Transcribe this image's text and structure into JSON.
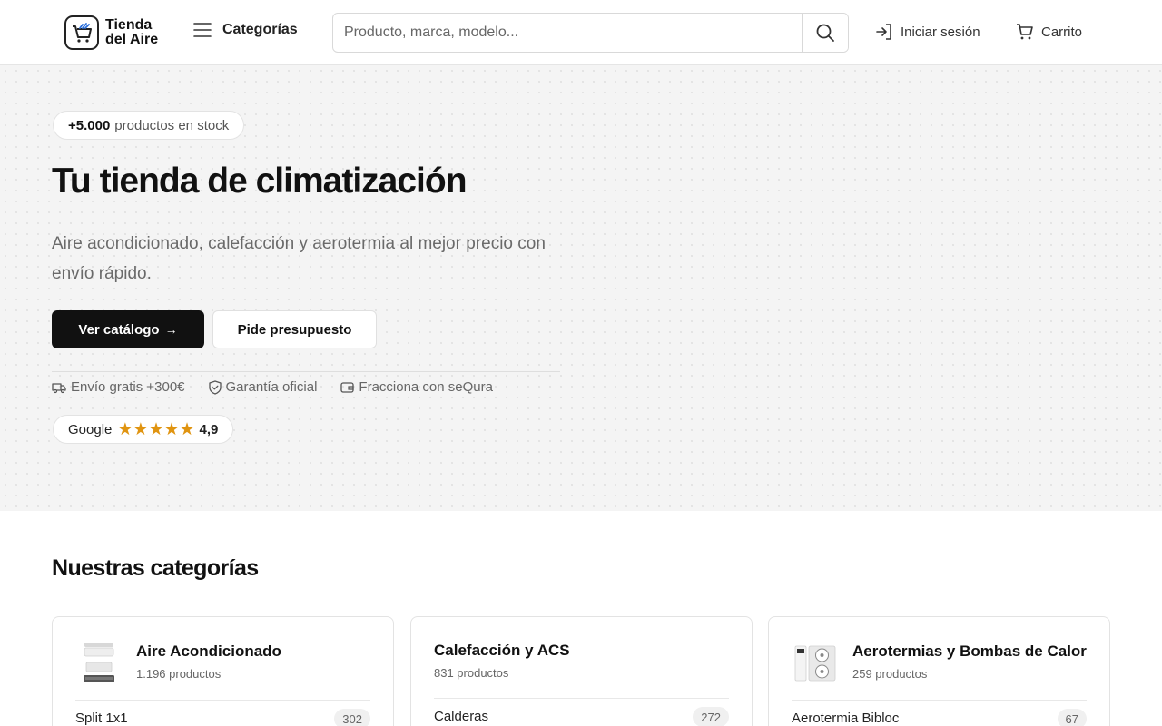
{
  "header": {
    "logo_line1": "Tienda",
    "logo_line2": "del Aire",
    "categories_label": "Categorías",
    "search_placeholder": "Producto, marca, modelo...",
    "login_label": "Iniciar sesión",
    "cart_label": "Carrito"
  },
  "hero": {
    "badge_strong": "+5.000",
    "badge_text": "productos en stock",
    "title": "Tu tienda de climatización",
    "subtitle": "Aire acondicionado, calefacción y aerotermia al mejor precio con envío rápido.",
    "primary_button": "Ver catálogo",
    "secondary_button": "Pide presupuesto",
    "features": [
      {
        "label": "Envío gratis +300€",
        "icon": "truck-icon"
      },
      {
        "label": "Garantía oficial",
        "icon": "shield-icon"
      },
      {
        "label": "Fracciona con seQura",
        "icon": "wallet-icon"
      }
    ],
    "google": {
      "label": "Google",
      "stars": "★★★★★",
      "rating": "4,9"
    }
  },
  "categories": {
    "title": "Nuestras categorías",
    "cards": [
      {
        "name": "Aire Acondicionado",
        "count": "1.196 productos",
        "first_sub": {
          "label": "Split 1x1",
          "count": "302"
        }
      },
      {
        "name": "Calefacción y ACS",
        "count": "831 productos",
        "first_sub": {
          "label": "Calderas",
          "count": "272"
        }
      },
      {
        "name": "Aerotermias y Bombas de Calor",
        "count": "259 productos",
        "first_sub": {
          "label": "Aerotermia Bibloc",
          "count": "67"
        }
      }
    ]
  },
  "colors": {
    "primary_button_bg": "#111111",
    "hero_bg": "#f4f4f4",
    "star_color": "#e09410"
  }
}
